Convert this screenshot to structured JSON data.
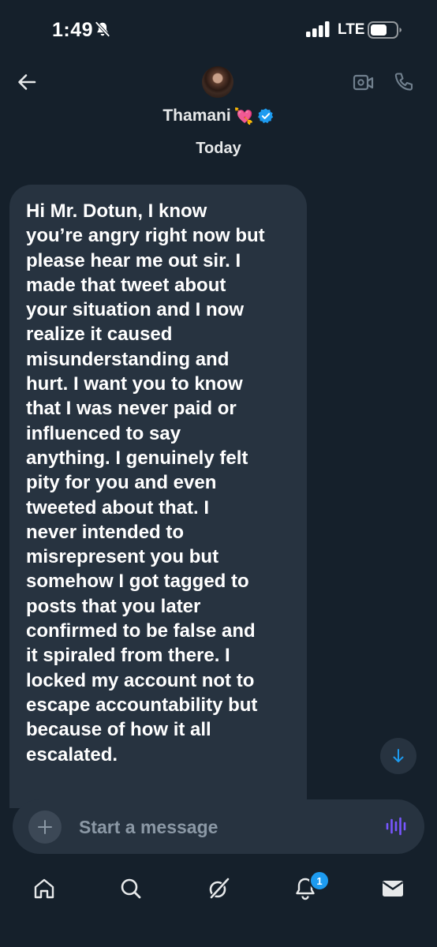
{
  "status_bar": {
    "time": "1:49",
    "network": "LTE",
    "icons": [
      "bell-slash-icon",
      "signal-bars-icon",
      "battery-icon"
    ]
  },
  "header": {
    "contact_name": "Thamani",
    "name_emoji": "💘",
    "verified": true,
    "icons": [
      "back-arrow-icon",
      "video-call-icon",
      "phone-icon",
      "verified-badge-icon"
    ]
  },
  "conversation": {
    "date_label": "Today",
    "messages": [
      {
        "sender": "Thamani",
        "text": "Hi Mr. Dotun, I know\nyou’re angry right now but\nplease hear me out sir. I\nmade that tweet about\nyour situation and I now\nrealize it caused\nmisunderstanding and\nhurt. I want you to know\nthat I was never paid or\ninfluenced to say\nanything. I genuinely felt\npity for you and even\ntweeted about that. I\nnever intended to\nmisrepresent you but\nsomehow I got tagged to\nposts that you later\nconfirmed to be false and\nit spiraled from there. I\nlocked my account not to\nescape accountability but\nbecause of how it all\nescalated."
      }
    ]
  },
  "composer": {
    "placeholder": "Start a message",
    "value": "",
    "icons": [
      "plus-icon",
      "voice-wave-icon"
    ]
  },
  "tab_bar": {
    "tabs": [
      "home",
      "search",
      "grok",
      "notifications",
      "messages"
    ],
    "notifications_badge": "1"
  },
  "colors": {
    "background": "#15202b",
    "bubble": "#273340",
    "accent": "#1d9bf0",
    "voice_accent": "#7856ff"
  }
}
